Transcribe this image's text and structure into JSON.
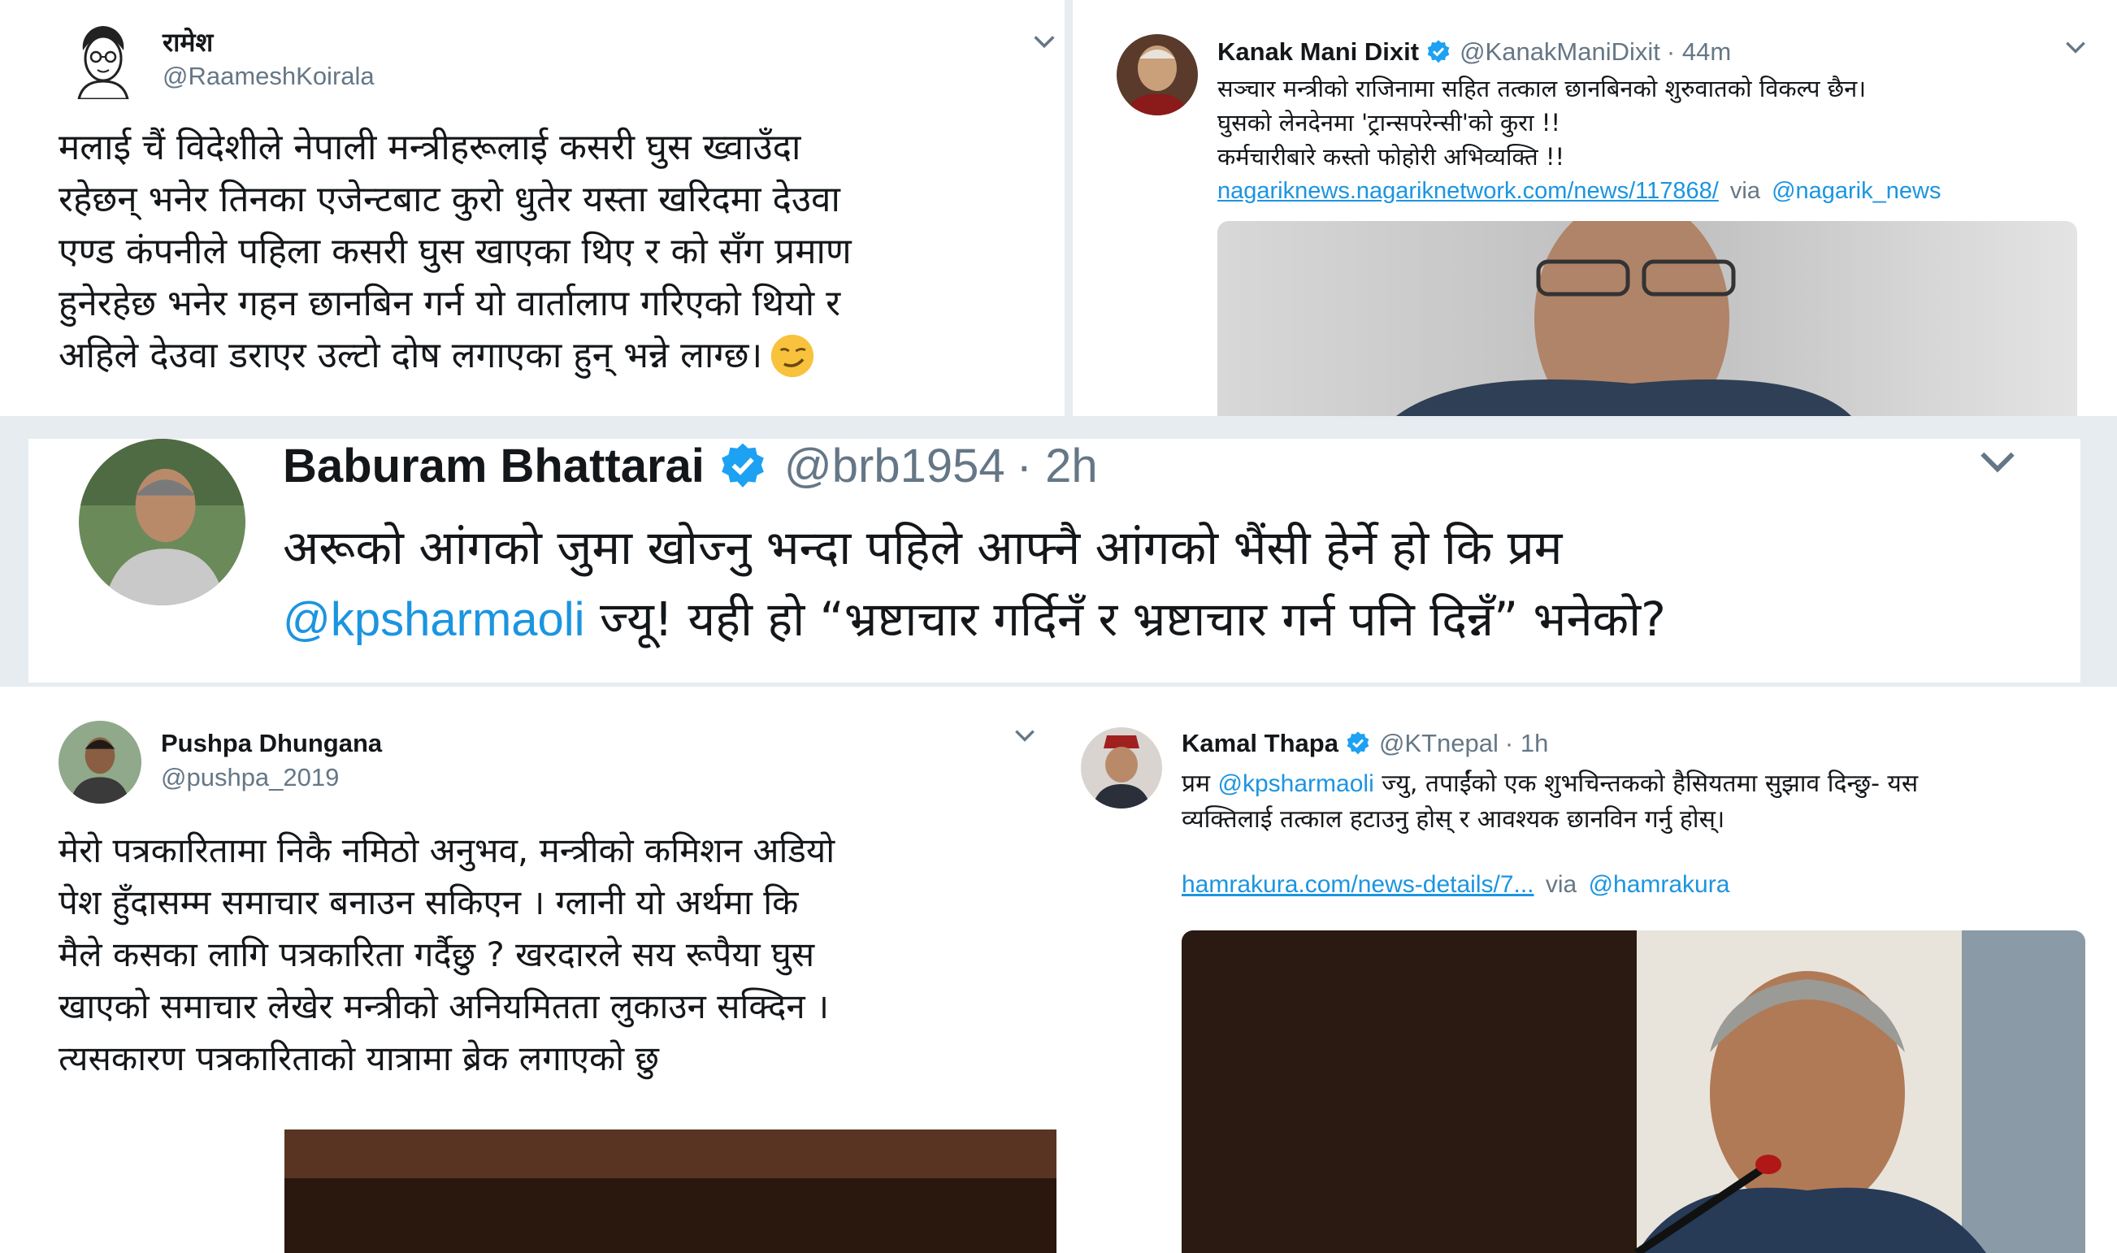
{
  "tweets": {
    "ramesh": {
      "name": "रामेश",
      "handle": "@RaameshKoirala",
      "lines": [
        "मलाई चैं विदेशीले नेपाली मन्त्रीहरूलाई कसरी घुस ख्वाउँदा",
        "रहेछन् भनेर तिनका एजेन्टबाट कुरो धुतेर यस्ता खरिदमा देउवा",
        "एण्ड कंपनीले पहिला कसरी घुस खाएका थिए र को सँग प्रमाण",
        "हुनेरहेछ भनेर गहन छानबिन गर्न यो वार्तालाप गरिएको थियो र",
        "अहिले देउवा डराएर उल्टो दोष लगाएका हुन् भन्ने लाग्छ।"
      ],
      "emoji": "smirk-emoji"
    },
    "kanak": {
      "name": "Kanak Mani Dixit",
      "handle": "@KanakManiDixit",
      "time": "· 44m",
      "lines": [
        "सञ्चार मन्त्रीको राजिनामा सहित तत्काल छानबिनको शुरुवातको विकल्प छैन।",
        "घुसको लेनदेनमा 'ट्रान्सपरेन्सी'को कुरा !!",
        "कर्मचारीबारे कस्तो फोहोरी अभिव्यक्ति !!"
      ],
      "link": "nagariknews.nagariknetwork.com/news/117868/",
      "via": "via",
      "via_handle": "@nagarik_news"
    },
    "baburam": {
      "name": "Baburam Bhattarai",
      "handle": "@brb1954",
      "time": "· 2h",
      "line1": "अरूको आंगको जुमा खोज्नु भन्दा पहिले आफ्नै आंगको भैंसी हेर्ने हो कि प्रम",
      "mention": "@kpsharmaoli",
      "line2_rest": " ज्यू! यही हो “भ्रष्टाचार गर्दिनँ र भ्रष्टाचार गर्न पनि दिन्नँ” भनेको?"
    },
    "pushpa": {
      "name": "Pushpa Dhungana",
      "handle": "@pushpa_2019",
      "lines": [
        "मेरो पत्रकारितामा निकै नमिठो अनुभव, मन्त्रीको कमिशन अडियो",
        "पेश हुँदासम्म समाचार बनाउन सकिएन । ग्लानी यो अर्थमा कि",
        "मैले कसका लागि पत्रकारिता गर्दैछु ? खरदारले सय रूपैया घुस",
        "खाएको समाचार लेखेर मन्त्रीको अनियमितता लुकाउन सक्दिन ।",
        "त्यसकारण पत्रकारिताको यात्रामा ब्रेक लगाएको छु"
      ]
    },
    "kamal": {
      "name": "Kamal Thapa",
      "handle": "@KTnepal",
      "time": "· 1h",
      "line1_prefix": "प्रम ",
      "mention": "@kpsharmaoli",
      "line1_rest": " ज्यु, तपाईंको एक शुभचिन्तकको हैसियतमा सुझाव दिन्छु- यस",
      "line2": "व्यक्तिलाई तत्काल हटाउनु होस् र आवश्यक छानविन गर्नु होस्।",
      "link": "hamrakura.com/news-details/7...",
      "via": "via",
      "via_handle": "@hamrakura"
    }
  },
  "icons": {
    "verified": "verified-badge-icon",
    "chevron": "chevron-down-icon"
  },
  "colors": {
    "link": "#1b95e0",
    "secondary_text": "#657786",
    "verified": "#1da1f2"
  }
}
